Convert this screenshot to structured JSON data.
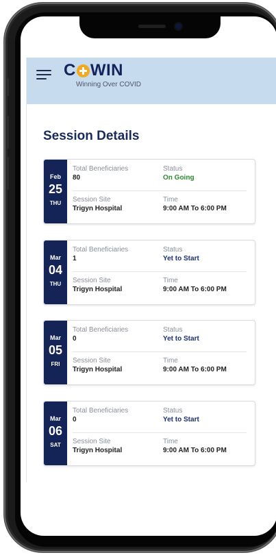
{
  "app": {
    "logo_prefix": "C",
    "logo_suffix": "WIN",
    "tagline": "Winning Over COVID"
  },
  "page_title": "Session Details",
  "labels": {
    "beneficiaries": "Total Beneficiaries",
    "status": "Status",
    "site": "Session Site",
    "time": "Time"
  },
  "sessions": [
    {
      "month": "Feb",
      "day": "25",
      "weekday": "THU",
      "beneficiaries": "80",
      "status": "On Going",
      "site": "Trigyn Hospital",
      "time": "9:00 AM To 6:00 PM"
    },
    {
      "month": "Mar",
      "day": "04",
      "weekday": "THU",
      "beneficiaries": "1",
      "status": "Yet to Start",
      "site": "Trigyn Hospital",
      "time": "9:00 AM To 6:00 PM"
    },
    {
      "month": "Mar",
      "day": "05",
      "weekday": "FRI",
      "beneficiaries": "0",
      "status": "Yet to Start",
      "site": "Trigyn Hospital",
      "time": "9:00 AM To 6:00 PM"
    },
    {
      "month": "Mar",
      "day": "06",
      "weekday": "SAT",
      "beneficiaries": "0",
      "status": "Yet to Start",
      "site": "Trigyn Hospital",
      "time": "9:00 AM To 6:00 PM"
    }
  ],
  "colors": {
    "header_bg": "#c7dbef",
    "brand_navy": "#152457",
    "logo_orange": "#f3a91f",
    "status_ongoing": "#2e8b2e",
    "status_pending": "#1a2f74"
  },
  "icons": {
    "menu": "hamburger-menu-icon",
    "logo_mark": "plus-circle-icon"
  }
}
